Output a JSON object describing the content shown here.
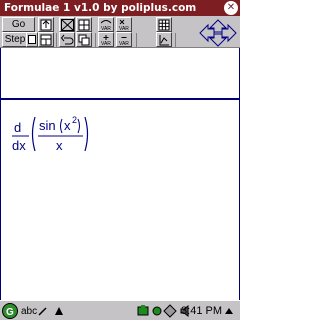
{
  "window": {
    "title": "Formulae 1 v1.0 by poliplus.com"
  },
  "toolbar": {
    "go_label": "Go",
    "step_label": "Step",
    "icons": [
      "upload-icon",
      "table-icon",
      "graph-icon",
      "var-plus-icon",
      "grid-icon",
      "arrows-icon",
      "clip-icon",
      "copy-icon",
      "var-x-icon",
      "var-minus-icon",
      "plot-icon",
      "download-icon"
    ]
  },
  "formula": {
    "d_top": "d",
    "d_bottom": "dx",
    "func": "sin",
    "arg": "x",
    "exponent": "2",
    "denominator": "x"
  },
  "taskbar": {
    "start_icon": "g-logo-icon",
    "keyboard_label": "abc",
    "time": "3:41 PM"
  },
  "colors": {
    "title_bg": "#7d1e22",
    "pane_border": "#00007b",
    "formula_text": "#000084",
    "toolbar_bg": "#c6c3c6"
  }
}
